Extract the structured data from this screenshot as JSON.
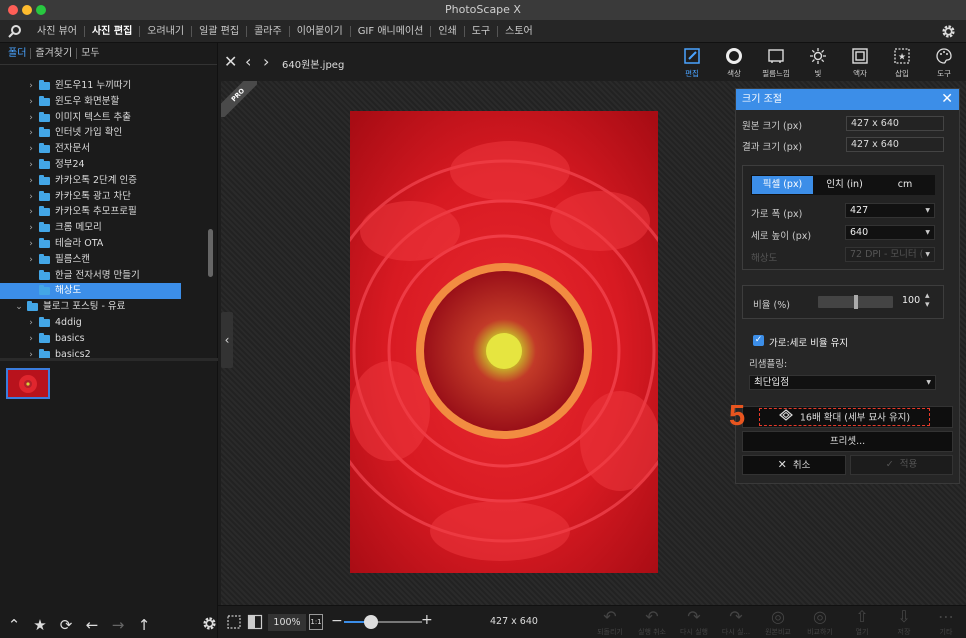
{
  "app": {
    "title": "PhotoScape X"
  },
  "menu": {
    "items": [
      "사진 뷰어",
      "사진 편집",
      "오려내기",
      "일괄 편집",
      "콜라주",
      "이어붙이기",
      "GIF 애니메이션",
      "인쇄",
      "도구",
      "스토어"
    ],
    "active": "사진 편집"
  },
  "sidebar": {
    "tabs": [
      "폴더",
      "즐겨찾기",
      "모두"
    ],
    "tree": [
      {
        "label": "윈도우11 누끼따기",
        "chev": "›"
      },
      {
        "label": "윈도우 화면분할",
        "chev": "›"
      },
      {
        "label": "이미지 텍스트 추출",
        "chev": "›"
      },
      {
        "label": "인터넷 가입 확인",
        "chev": "›"
      },
      {
        "label": "전자문서",
        "chev": "›"
      },
      {
        "label": "정부24",
        "chev": "›"
      },
      {
        "label": "카카오톡 2단계 인증",
        "chev": "›"
      },
      {
        "label": "카카오톡 광고 차단",
        "chev": "›"
      },
      {
        "label": "카카오톡 추모프로필",
        "chev": "›"
      },
      {
        "label": "크롬 메모리",
        "chev": "›"
      },
      {
        "label": "테슬라 OTA",
        "chev": "›"
      },
      {
        "label": "필름스캔",
        "chev": "›"
      },
      {
        "label": "한글 전자서명 만들기",
        "chev": ""
      },
      {
        "label": "해상도",
        "chev": "",
        "selected": true
      },
      {
        "label": "블로그 포스팅 - 유료",
        "chev": "⌄"
      },
      {
        "label": "4ddig",
        "chev": "›"
      },
      {
        "label": "basics",
        "chev": "›"
      },
      {
        "label": "basics2",
        "chev": "›"
      }
    ]
  },
  "toolbar": {
    "filename": "640원본.jpeg",
    "tools": [
      "편집",
      "색상",
      "필름느낌",
      "빛",
      "액자",
      "삽입",
      "도구"
    ],
    "active_tool": "편집"
  },
  "canvas": {
    "badge": "PRO"
  },
  "resize_panel": {
    "title": "크기 조절",
    "original_label": "원본 크기 (px)",
    "original_value": "427 x 640",
    "result_label": "결과 크기 (px)",
    "result_value": "427 x 640",
    "units": [
      "픽셀 (px)",
      "인치 (in)",
      "cm"
    ],
    "active_unit": "픽셀 (px)",
    "width_label": "가로 폭 (px)",
    "width_value": "427",
    "height_label": "세로 높이 (px)",
    "height_value": "640",
    "resolution_label": "해상도",
    "resolution_value": "72 DPI - 모니터 (",
    "ratio_label": "비율 (%)",
    "ratio_value": "100",
    "ratio_level": 0.5,
    "keep_aspect_label": "가로:세로 비율 유지",
    "keep_aspect_checked": true,
    "resampling_label": "리샘플링:",
    "resampling_value": "최단입점",
    "upscale_label": "16배 확대 (세부 묘사 유지)",
    "preset_label": "프리셋...",
    "cancel_label": "취소",
    "apply_label": "적용",
    "step_marker": "5"
  },
  "bottombar": {
    "zoom": "100%",
    "one_to_one": "1:1",
    "zoom_level": 0.35,
    "image_size": "427 x 640",
    "actions": [
      "되돌리기",
      "실행 취소",
      "다시 실행",
      "다시 실...",
      "원본비교",
      "비교하기",
      "열기",
      "저장",
      "기타"
    ]
  },
  "colors": {
    "accent": "#3c8ee8",
    "folder": "#43a6e6",
    "marker": "#e8551f",
    "close": "#ff5f57",
    "minimize": "#febc2e",
    "zoom": "#28c840"
  }
}
